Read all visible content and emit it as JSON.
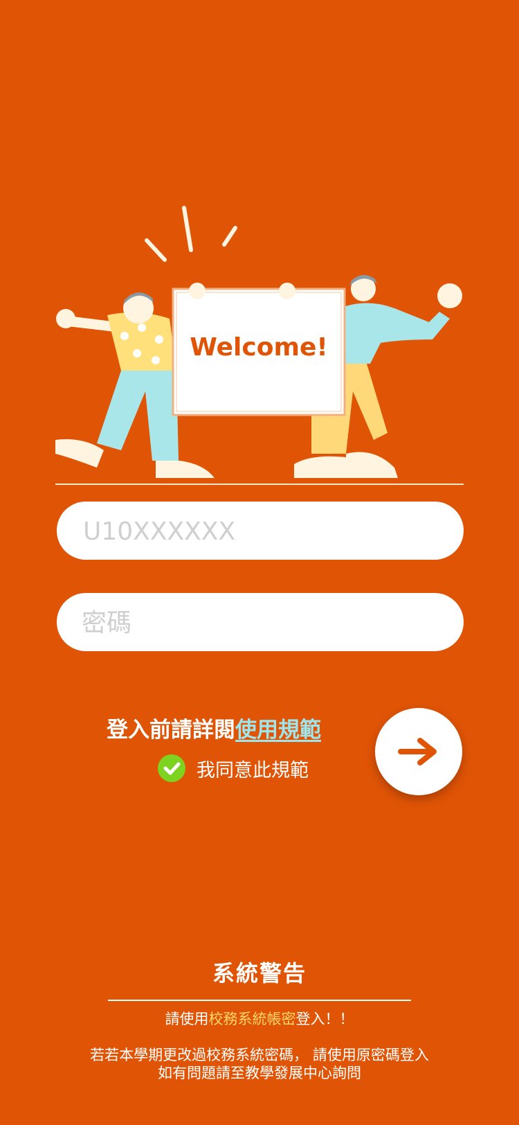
{
  "hero": {
    "sign_text": "Welcome!"
  },
  "login": {
    "account_placeholder": "U10XXXXXX",
    "account_value": "",
    "password_placeholder": "密碼",
    "password_value": ""
  },
  "terms": {
    "prefix": "登入前請詳閱",
    "link": "使用規範",
    "agree": "我同意此規範",
    "checked": true
  },
  "submit_icon": "arrow-right-icon",
  "warning": {
    "title": "系統警告",
    "line1_prefix": "請使用",
    "line1_highlight": "校務系統帳密",
    "line1_suffix": "登入！！",
    "line2": "若若本學期更改過校務系統密碼， 請使用原密碼登入",
    "line3": "如有問題請至教學發展中心詢問"
  },
  "colors": {
    "background": "#E05406",
    "link": "#9EE6EE",
    "highlight": "#FFD76A",
    "check": "#7ED321"
  }
}
